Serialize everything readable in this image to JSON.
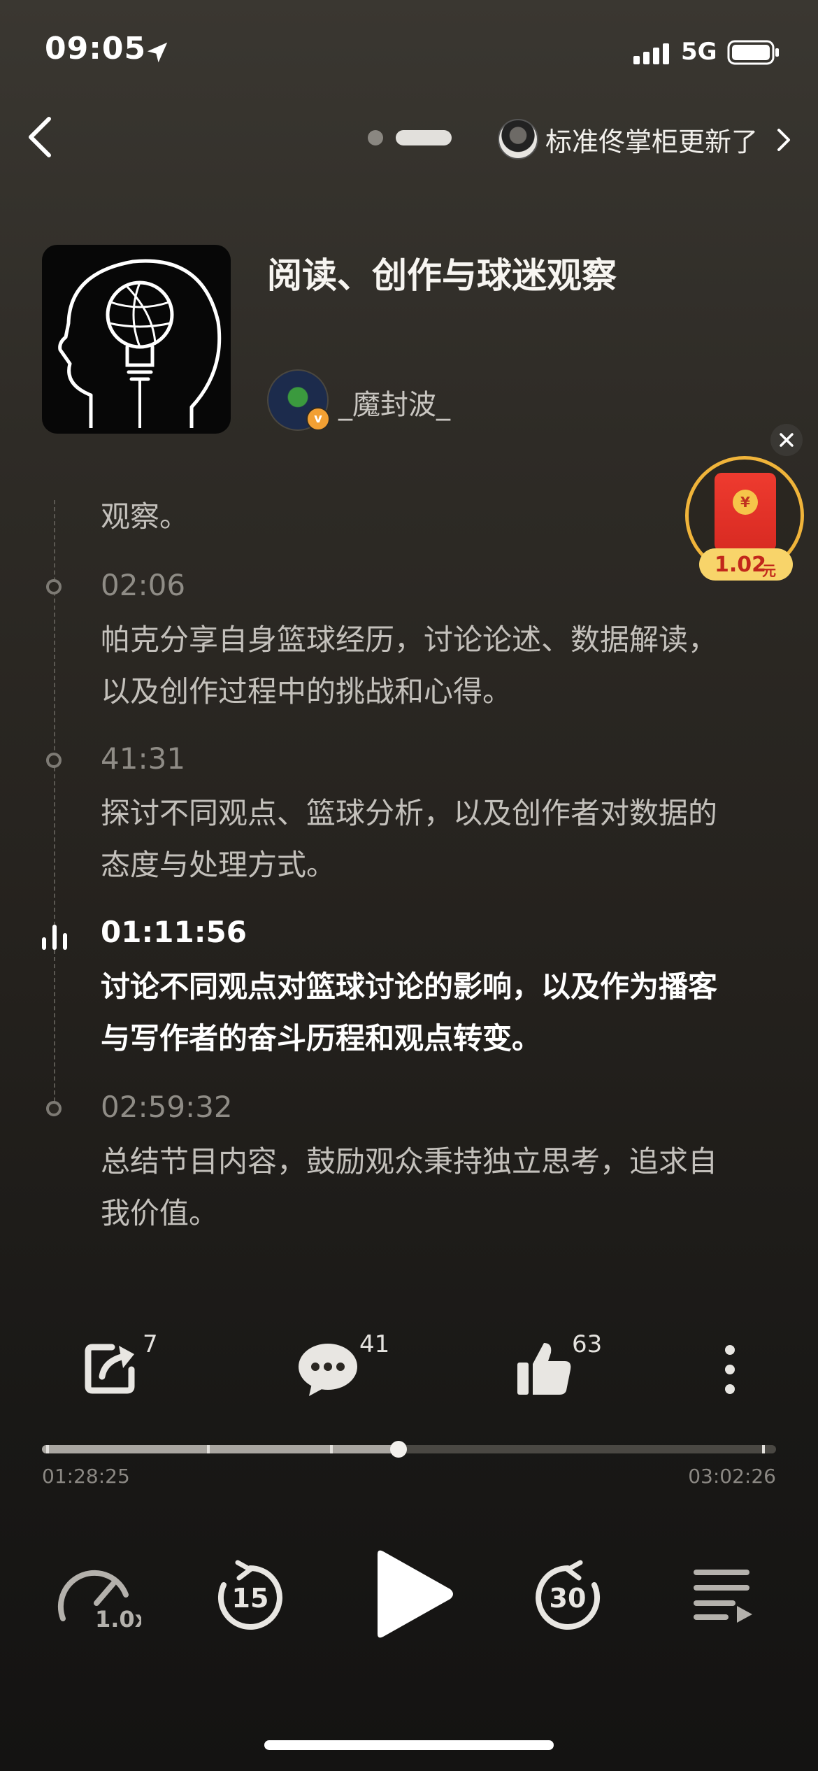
{
  "status_bar": {
    "time": "09:05",
    "network": "5G"
  },
  "nav": {
    "update_text": "标准佟掌柜更新了"
  },
  "podcast": {
    "title": "阅读、创作与球迷观察",
    "author": "_魔封波_"
  },
  "red_packet": {
    "amount": "1.02",
    "unit": "元",
    "coin_symbol": "¥"
  },
  "chapters": [
    {
      "time": "",
      "text": "观察。",
      "active": false
    },
    {
      "time": "02:06",
      "text": "帕克分享自身篮球经历，讨论论述、数据解读，以及创作过程中的挑战和心得。",
      "active": false
    },
    {
      "time": "41:31",
      "text": "探讨不同观点、篮球分析，以及创作者对数据的态度与处理方式。",
      "active": false
    },
    {
      "time": "01:11:56",
      "text": "讨论不同观点对篮球讨论的影响，以及作为播客与写作者的奋斗历程和观点转变。",
      "active": true
    },
    {
      "time": "02:59:32",
      "text": "总结节目内容，鼓励观众秉持独立思考，追求自我价值。",
      "active": false
    }
  ],
  "actions": {
    "share_count": "7",
    "comment_count": "41",
    "like_count": "63"
  },
  "player": {
    "current_time": "01:28:25",
    "total_time": "03:02:26",
    "progress": 0.486,
    "speed": "1.0x",
    "rewind_seconds": "15",
    "forward_seconds": "30"
  },
  "colors": {
    "accent_gold": "#f0b43a",
    "red_packet": "#e3352a",
    "background": "#2e2b26"
  }
}
